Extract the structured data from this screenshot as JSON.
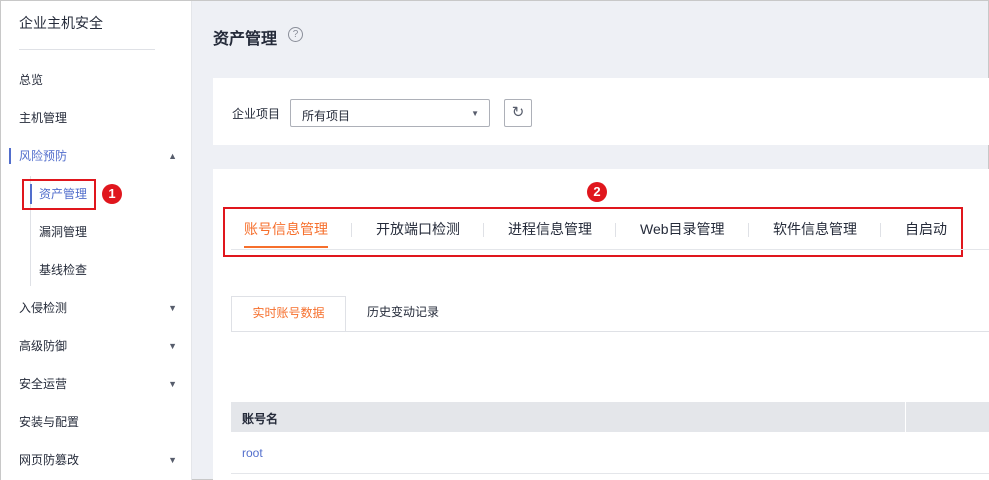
{
  "sidebar": {
    "title": "企业主机安全",
    "items": [
      {
        "label": "总览"
      },
      {
        "label": "主机管理"
      },
      {
        "label": "风险预防",
        "chevron": "▲"
      },
      {
        "label": "入侵检测",
        "chevron": "▼"
      },
      {
        "label": "高级防御",
        "chevron": "▼"
      },
      {
        "label": "安全运营",
        "chevron": "▼"
      },
      {
        "label": "安装与配置"
      },
      {
        "label": "网页防篡改",
        "chevron": "▼"
      }
    ],
    "subitems": [
      {
        "label": "资产管理"
      },
      {
        "label": "漏洞管理"
      },
      {
        "label": "基线检查"
      }
    ]
  },
  "callouts": {
    "one": "1",
    "two": "2"
  },
  "header": {
    "title": "资产管理",
    "help_glyph": "?"
  },
  "filter": {
    "label": "企业项目",
    "select_value": "所有项目",
    "select_caret": "▼",
    "refresh_glyph": "↻"
  },
  "tabs": [
    {
      "label": "账号信息管理"
    },
    {
      "label": "开放端口检测"
    },
    {
      "label": "进程信息管理"
    },
    {
      "label": "Web目录管理"
    },
    {
      "label": "软件信息管理"
    },
    {
      "label": "自启动"
    }
  ],
  "subtabs": [
    {
      "label": "实时账号数据"
    },
    {
      "label": "历史变动记录"
    }
  ],
  "table": {
    "columns": [
      "账号名"
    ],
    "rows": [
      [
        "root"
      ]
    ]
  },
  "colors": {
    "accent": "#f66f2c",
    "link": "#526ecc",
    "callout": "#e0161d"
  },
  "icons": [
    "help-icon",
    "chevron-up-icon",
    "chevron-down-icon",
    "caret-down-icon",
    "refresh-icon"
  ]
}
